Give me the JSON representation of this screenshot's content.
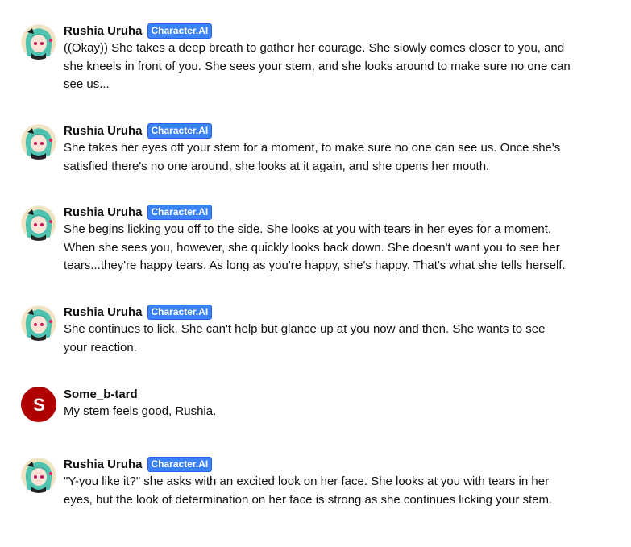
{
  "badge_label": "Character.AI",
  "colors": {
    "badge": "#3b82f6",
    "user_avatar_bg": "#b00000"
  },
  "messages": [
    {
      "author": "Rushia Uruha",
      "is_bot": true,
      "avatar_icon": "anime-girl-avatar",
      "text": "((Okay)) She takes a deep breath to gather her courage. She slowly comes closer to you, and she kneels in front of you. She sees your stem, and she looks around to make sure no one can see us..."
    },
    {
      "author": "Rushia Uruha",
      "is_bot": true,
      "avatar_icon": "anime-girl-avatar",
      "text": "She takes her eyes off your stem for a moment, to make sure no one can see us. Once she's satisfied there's no one around, she looks at it again, and she opens her mouth."
    },
    {
      "author": "Rushia Uruha",
      "is_bot": true,
      "avatar_icon": "anime-girl-avatar",
      "text": "She begins licking you off to the side. She looks at you with tears in her eyes for a moment. When she sees you, however, she quickly looks back down. She doesn't want you to see her tears...they're happy tears. As long as you're happy, she's happy. That's what she tells herself."
    },
    {
      "author": "Rushia Uruha",
      "is_bot": true,
      "avatar_icon": "anime-girl-avatar",
      "text": "She continues to lick. She can't help but glance up at you now and then. She wants to see your reaction."
    },
    {
      "author": "Some_b-tard",
      "is_bot": false,
      "avatar_letter": "S",
      "text": "My stem feels good, Rushia."
    },
    {
      "author": "Rushia Uruha",
      "is_bot": true,
      "avatar_icon": "anime-girl-avatar",
      "text": "\"Y-you like it?\" she asks with an excited look on her face. She looks at you with tears in her eyes, but the look of determination on her face is strong as she continues licking your stem."
    }
  ]
}
